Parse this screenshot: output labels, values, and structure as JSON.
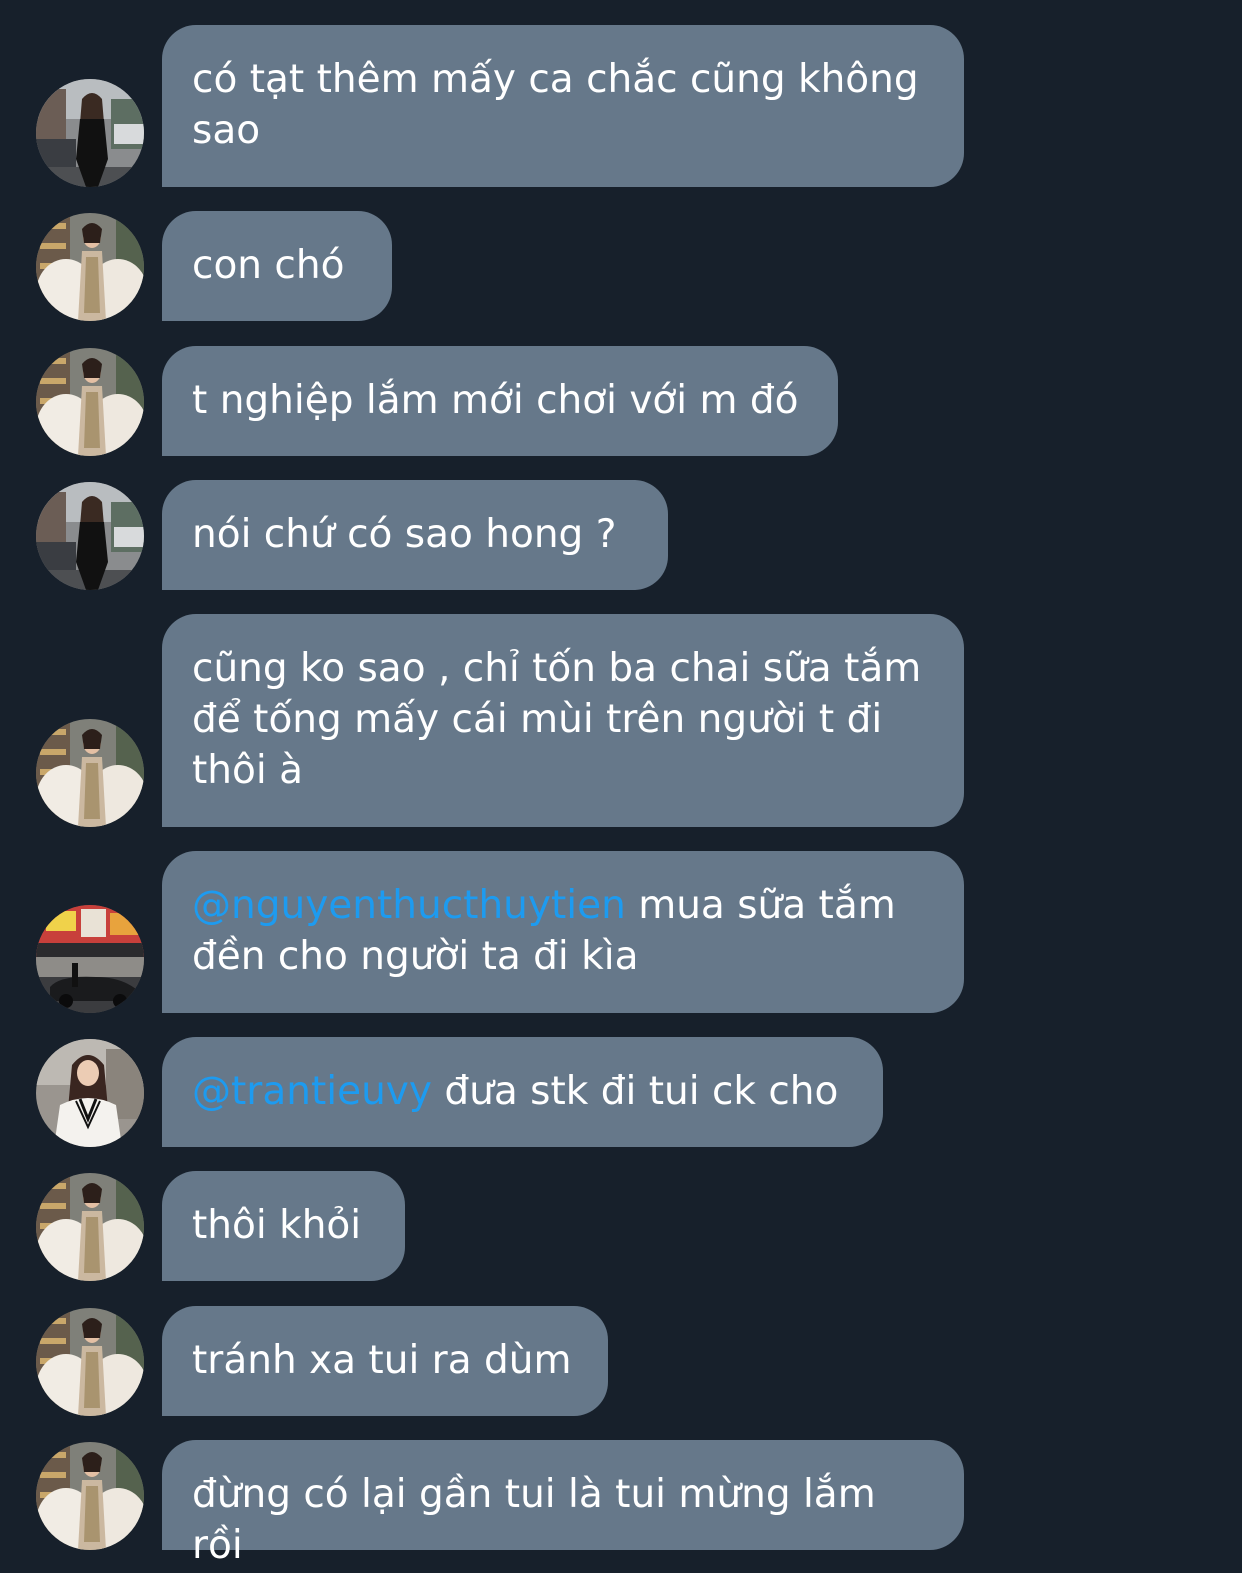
{
  "colors": {
    "background": "#17202b",
    "bubble": "#66788a",
    "text": "#ffffff",
    "mention": "#1d9bf0"
  },
  "avatars": {
    "a": "black-outfit-street-avatar",
    "b": "white-fur-gown-avatar",
    "c": "storefront-car-avatar",
    "d": "white-knit-vest-avatar"
  },
  "messages": [
    {
      "avatar": "a",
      "text": "có tạt thêm mấy ca chắc cũng không sao"
    },
    {
      "avatar": "b",
      "text": "con chó"
    },
    {
      "avatar": "b",
      "text": "t nghiệp lắm mới chơi với m đó"
    },
    {
      "avatar": "a",
      "text": "nói chứ có sao hong ?"
    },
    {
      "avatar": "b",
      "text": "cũng ko sao , chỉ tốn ba chai sữa tắm để tống mấy cái mùi trên người t đi thôi à"
    },
    {
      "avatar": "c",
      "mention": "@nguyenthucthuytien",
      "text": " mua sữa tắm đền cho người ta đi kìa"
    },
    {
      "avatar": "d",
      "mention": "@trantieuvy",
      "text": " đưa stk đi tui ck cho"
    },
    {
      "avatar": "b",
      "text": "thôi khỏi"
    },
    {
      "avatar": "b",
      "text": "tránh xa tui ra dùm"
    },
    {
      "avatar": "b",
      "text": "đừng có lại gần tui là tui mừng lắm rồi"
    }
  ]
}
